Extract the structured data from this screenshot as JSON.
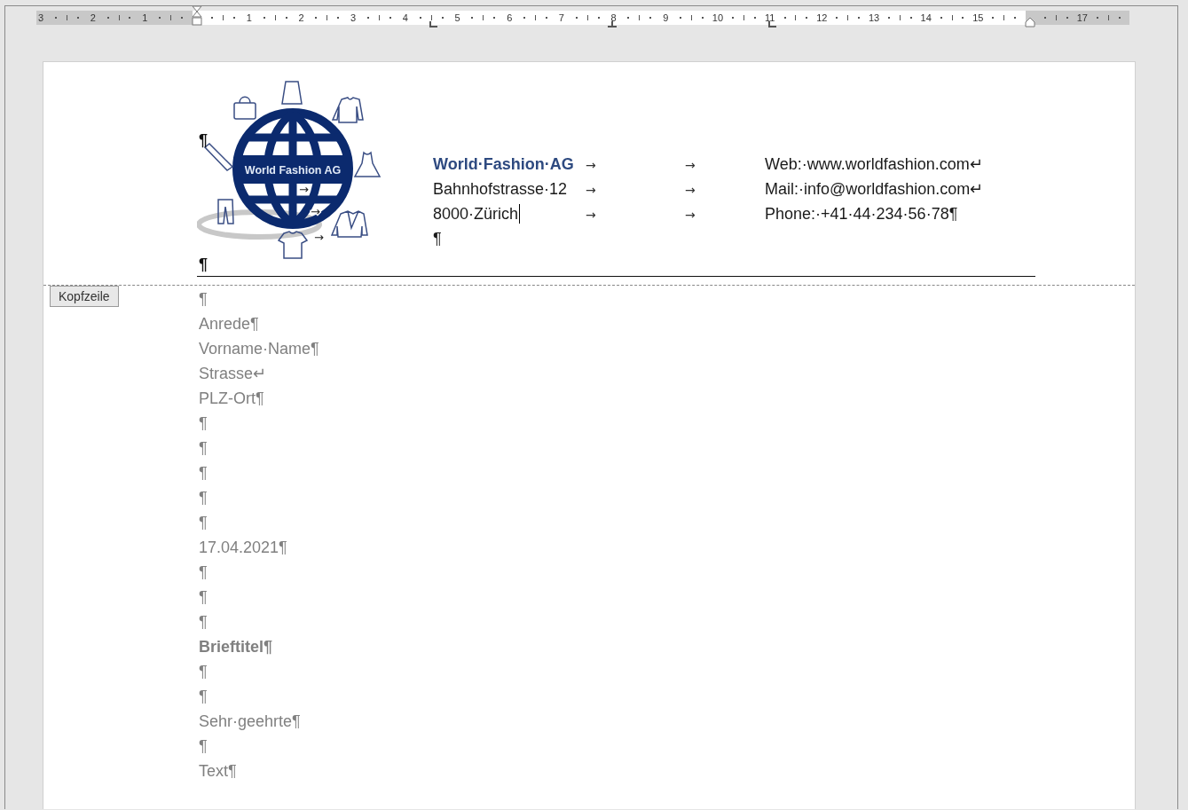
{
  "ruler": {
    "left_numbers": [
      "3",
      "2",
      "1"
    ],
    "numbers": [
      "1",
      "2",
      "3",
      "4",
      "5",
      "6",
      "7",
      "8",
      "9",
      "10",
      "11",
      "12",
      "13",
      "14",
      "15"
    ],
    "right_numbers": [
      "17"
    ]
  },
  "logo": {
    "text": "World Fashion AG",
    "tab_marks": [
      "→",
      "→",
      "→"
    ]
  },
  "header": {
    "marks": [
      "¶",
      "¶"
    ],
    "rows": [
      {
        "kind": "company",
        "left": "World·Fashion·AG",
        "tab_marks": [
          "→",
          "→"
        ],
        "right": "Web:·www.worldfashion.com↵",
        "cursor": false
      },
      {
        "kind": "plain",
        "left": "Bahnhofstrasse·12",
        "tab_marks": [
          "→",
          "→"
        ],
        "right": "Mail:·info@worldfashion.com↵",
        "cursor": false
      },
      {
        "kind": "plain",
        "left": "8000·Zürich",
        "tab_marks": [
          "→",
          "→"
        ],
        "right": "Phone:·+41·44·234·56·78¶",
        "cursor": true
      },
      {
        "kind": "plain",
        "left": "¶",
        "cursor": false
      }
    ]
  },
  "header_tag": {
    "label": "Kopfzeile"
  },
  "body": {
    "lines": [
      {
        "kind": "plain",
        "text": "¶"
      },
      {
        "kind": "plain",
        "text": "Anrede¶"
      },
      {
        "kind": "plain",
        "text": "Vorname·Name¶"
      },
      {
        "kind": "plain",
        "text": "Strasse↵"
      },
      {
        "kind": "plain",
        "text": "PLZ-Ort¶"
      },
      {
        "kind": "plain",
        "text": "¶"
      },
      {
        "kind": "plain",
        "text": "¶"
      },
      {
        "kind": "plain",
        "text": "¶"
      },
      {
        "kind": "plain",
        "text": "¶"
      },
      {
        "kind": "plain",
        "text": "¶"
      },
      {
        "kind": "plain",
        "text": "17.04.2021¶"
      },
      {
        "kind": "plain",
        "text": "¶"
      },
      {
        "kind": "plain",
        "text": "¶"
      },
      {
        "kind": "plain",
        "text": "¶"
      },
      {
        "kind": "title",
        "text": "Brieftitel¶"
      },
      {
        "kind": "plain",
        "text": "¶"
      },
      {
        "kind": "plain",
        "text": "¶"
      },
      {
        "kind": "plain",
        "text": "Sehr·geehrte¶"
      },
      {
        "kind": "plain",
        "text": "¶"
      },
      {
        "kind": "plain",
        "text": "Text¶"
      }
    ]
  }
}
